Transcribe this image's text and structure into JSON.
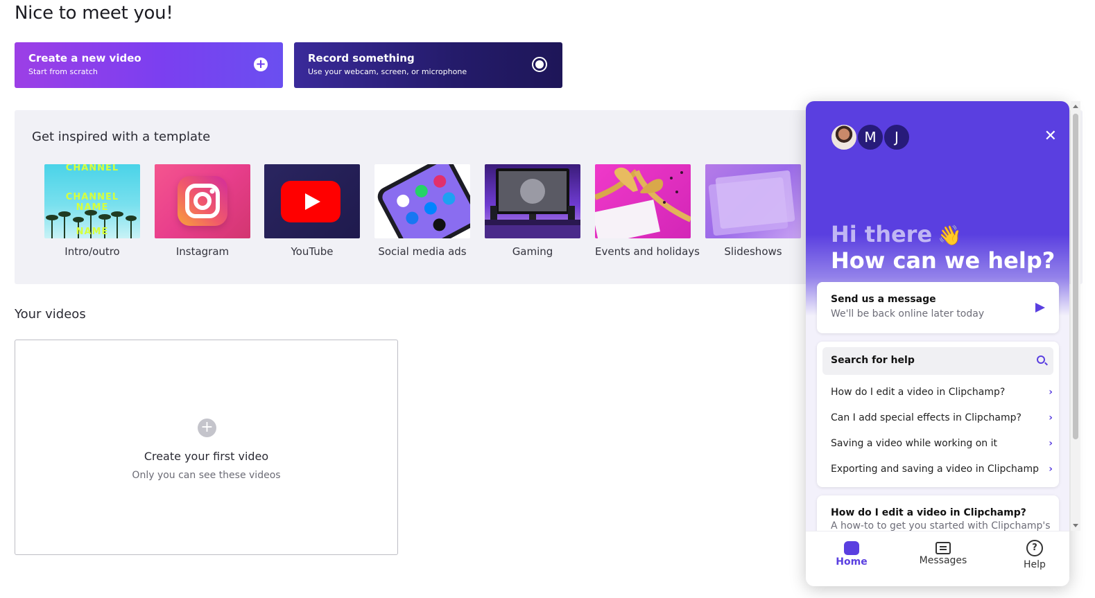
{
  "page": {
    "greeting": "Nice to meet you!"
  },
  "actions": {
    "create": {
      "title": "Create a new video",
      "subtitle": "Start from scratch",
      "icon": "plus-circle-icon"
    },
    "record": {
      "title": "Record something",
      "subtitle": "Use your webcam, screen, or microphone",
      "icon": "record-icon"
    }
  },
  "templates": {
    "title": "Get inspired with a template",
    "items": [
      {
        "label": "Intro/outro",
        "thumb_text_a": "CHANNEL",
        "thumb_text_b": "NAME",
        "thumb_text_c": "NAME"
      },
      {
        "label": "Instagram"
      },
      {
        "label": "YouTube"
      },
      {
        "label": "Social media ads"
      },
      {
        "label": "Gaming"
      },
      {
        "label": "Events and holidays"
      },
      {
        "label": "Slideshows"
      }
    ]
  },
  "your_videos": {
    "title": "Your videos",
    "empty_title": "Create your first video",
    "empty_subtitle": "Only you can see these videos"
  },
  "chat": {
    "avatars": [
      "M",
      "J"
    ],
    "greeting_line": "Hi there",
    "wave_glyph": "👋",
    "question": "How can we help?",
    "message_card": {
      "title": "Send us a message",
      "subtitle": "We'll be back online later today"
    },
    "search_label": "Search for help",
    "faqs": [
      "How do I edit a video in Clipchamp?",
      "Can I add special effects in Clipchamp?",
      "Saving a video while working on it",
      "Exporting and saving a video in Clipchamp"
    ],
    "article": {
      "title": "How do I edit a video in Clipchamp?",
      "snippet": "A how-to to get you started with Clipchamp's"
    },
    "nav": {
      "home": "Home",
      "messages": "Messages",
      "help": "Help"
    },
    "accent_color": "#5a3fe0"
  }
}
